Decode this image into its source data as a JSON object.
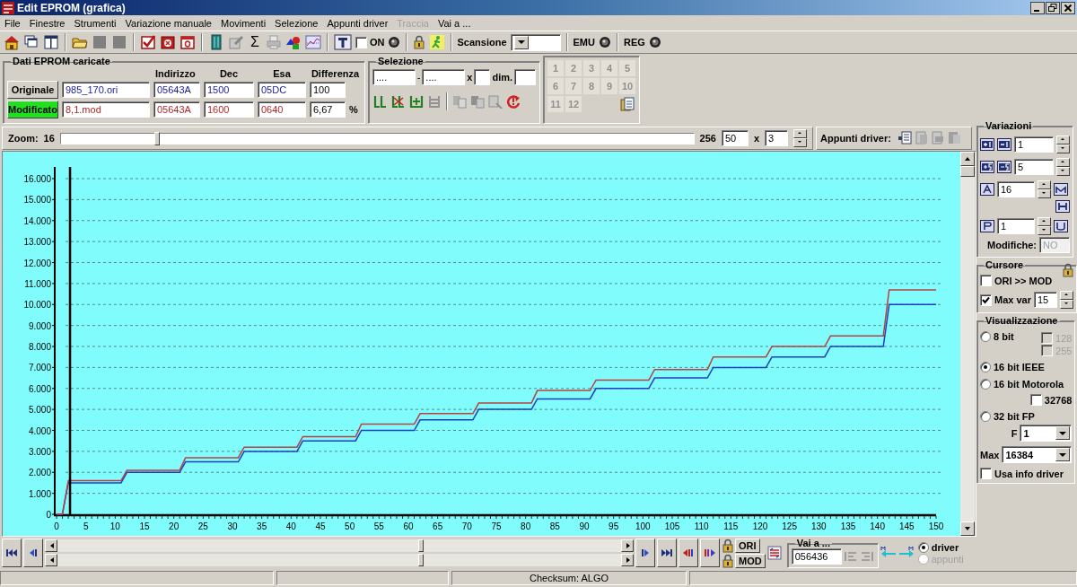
{
  "window": {
    "title": "Edit EPROM (grafica)"
  },
  "menu": [
    {
      "label": "File",
      "disabled": false
    },
    {
      "label": "Finestre",
      "disabled": false
    },
    {
      "label": "Strumenti",
      "disabled": false
    },
    {
      "label": "Variazione manuale",
      "disabled": false
    },
    {
      "label": "Movimenti",
      "disabled": false
    },
    {
      "label": "Selezione",
      "disabled": false
    },
    {
      "label": "Appunti driver",
      "disabled": false
    },
    {
      "label": "Traccia",
      "disabled": true
    },
    {
      "label": "Vai a ...",
      "disabled": false
    }
  ],
  "toolbar": {
    "sum_glyph": "Σ",
    "on_toggle": {
      "label": "ON",
      "checked": false
    },
    "scan_label": "Scansione",
    "emu_label": "EMU",
    "reg_label": "REG"
  },
  "eprom": {
    "title": "Dati EPROM caricate",
    "columns": [
      "Indirizzo",
      "Dec",
      "Esa",
      "Differenza"
    ],
    "rows": [
      {
        "button": "Originale",
        "selected": false,
        "file": "985_170.ori",
        "address": "05643A",
        "dec": "1500",
        "hex": "05DC",
        "diff": "100"
      },
      {
        "button": "Modificato",
        "selected": true,
        "file": "8,1.mod",
        "address": "05643A",
        "dec": "1600",
        "hex": "0640",
        "diff": "6,67",
        "unit": "%"
      }
    ]
  },
  "selection": {
    "title": "Selezione",
    "from": "....",
    "separator": "-",
    "to": "....",
    "times": "x",
    "dim_label": "dim."
  },
  "slots": [
    {
      "label": "1",
      "disabled": true
    },
    {
      "label": "2",
      "disabled": true
    },
    {
      "label": "3",
      "disabled": true
    },
    {
      "label": "4",
      "disabled": true
    },
    {
      "label": "5",
      "disabled": true
    },
    {
      "label": "6",
      "disabled": true
    },
    {
      "label": "7",
      "disabled": true
    },
    {
      "label": "8",
      "disabled": true
    },
    {
      "label": "9",
      "disabled": true
    },
    {
      "label": "10",
      "disabled": true
    },
    {
      "label": "11",
      "disabled": true
    },
    {
      "label": "12",
      "disabled": true
    }
  ],
  "zoom": {
    "label": "Zoom:",
    "min": "16",
    "max": "256",
    "level": 0.148,
    "value": "50",
    "times": "x",
    "factor": "3"
  },
  "driver_clip": {
    "label": "Appunti driver:"
  },
  "chart": {
    "chart_data": {
      "type": "line",
      "x": [
        0,
        1,
        2,
        11,
        12,
        21,
        22,
        31,
        32,
        41,
        42,
        51,
        52,
        61,
        62,
        71,
        72,
        81,
        82,
        91,
        92,
        101,
        102,
        111,
        112,
        121,
        122,
        131,
        132,
        141,
        142,
        150
      ],
      "series": [
        {
          "color": "#1f3fbf",
          "values": [
            0,
            0,
            1500,
            1500,
            2000,
            2000,
            2500,
            2500,
            3000,
            3000,
            3500,
            3500,
            4000,
            4000,
            4500,
            4500,
            5000,
            5000,
            5500,
            5500,
            6000,
            6000,
            6500,
            6500,
            7000,
            7000,
            7500,
            7500,
            8000,
            8000,
            10000,
            10000
          ]
        },
        {
          "color": "#b84040",
          "values": [
            0,
            0,
            1600,
            1600,
            2100,
            2100,
            2700,
            2700,
            3200,
            3200,
            3700,
            3700,
            4300,
            4300,
            4800,
            4800,
            5300,
            5300,
            5900,
            5900,
            6400,
            6400,
            6900,
            6900,
            7500,
            7500,
            8000,
            8000,
            8500,
            8500,
            10700,
            10700
          ]
        }
      ],
      "grid": true,
      "ref_lines": [
        {
          "axis": "x",
          "value": 2.3,
          "color": "#000000"
        }
      ],
      "xlim": [
        0,
        150
      ],
      "ylim": [
        0,
        16000
      ],
      "xticks": [
        0,
        5,
        10,
        15,
        20,
        25,
        30,
        35,
        40,
        45,
        50,
        55,
        60,
        65,
        70,
        75,
        80,
        85,
        90,
        95,
        100,
        105,
        110,
        115,
        120,
        125,
        130,
        135,
        140,
        145,
        150
      ],
      "yticks": [
        0,
        {
          "value": 1000,
          "label": "1.000"
        },
        {
          "value": 2000,
          "label": "2.000"
        },
        {
          "value": 3000,
          "label": "3.000"
        },
        {
          "value": 4000,
          "label": "4.000"
        },
        {
          "value": 5000,
          "label": "5.000"
        },
        {
          "value": 6000,
          "label": "6.000"
        },
        {
          "value": 7000,
          "label": "7.000"
        },
        {
          "value": 8000,
          "label": "8.000"
        },
        {
          "value": 9000,
          "label": "9.000"
        },
        {
          "value": 10000,
          "label": "10.000"
        },
        {
          "value": 11000,
          "label": "11.000"
        },
        {
          "value": 12000,
          "label": "12.000"
        },
        {
          "value": 13000,
          "label": "13.000"
        },
        {
          "value": 14000,
          "label": "14.000"
        },
        {
          "value": 15000,
          "label": "15.000"
        },
        {
          "value": 16000,
          "label": "16.000"
        }
      ]
    }
  },
  "navigation": {
    "ori": "ORI",
    "mod": "MOD",
    "goto": {
      "title": "Vai a ...",
      "value": "056436"
    },
    "sources": [
      {
        "label": "driver",
        "selected": true,
        "disabled": false
      },
      {
        "label": "appunti",
        "selected": false,
        "disabled": true
      }
    ]
  },
  "variations": {
    "title": "Variazioni",
    "step_small": "1",
    "step_large": "5",
    "a_value": "16",
    "p_value": "1",
    "changes_label": "Modifiche:",
    "changes_value": "NO"
  },
  "cursor": {
    "title": "Cursore",
    "ori_to_mod": {
      "label": "ORI >> MOD",
      "checked": false
    },
    "max_var": {
      "label": "Max var",
      "checked": true,
      "value": "15"
    }
  },
  "display": {
    "title": "Visualizzazione",
    "modes": [
      {
        "label": "8 bit",
        "selected": false,
        "options": [
          {
            "label": "128",
            "checked": false,
            "disabled": true
          },
          {
            "label": "255",
            "checked": false,
            "disabled": true
          }
        ]
      },
      {
        "label": "16 bit IEEE",
        "selected": true
      },
      {
        "label": "16 bit Motorola",
        "selected": false,
        "options": [
          {
            "label": "32768",
            "checked": false,
            "disabled": false
          }
        ]
      },
      {
        "label": "32 bit FP",
        "selected": false
      }
    ],
    "f_label": "F",
    "f_value": "1",
    "max_label": "Max",
    "max_value": "16384",
    "driver_info": {
      "label": "Usa info driver",
      "checked": false
    }
  },
  "status_bar": {
    "checksum": "Checksum: ALGO"
  }
}
